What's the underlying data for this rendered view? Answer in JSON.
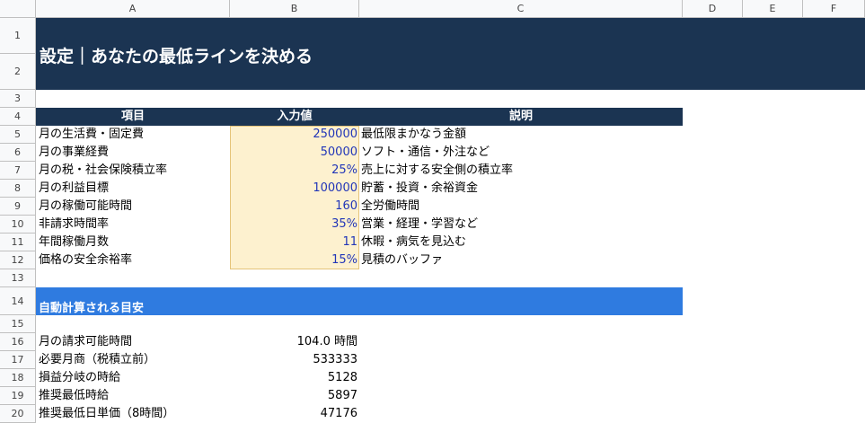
{
  "columns": [
    "A",
    "B",
    "C",
    "D",
    "E",
    "F"
  ],
  "rows": [
    "1",
    "2",
    "3",
    "4",
    "5",
    "6",
    "7",
    "8",
    "9",
    "10",
    "11",
    "12",
    "13",
    "14",
    "15",
    "16",
    "17",
    "18",
    "19",
    "20"
  ],
  "title": "設定｜あなたの最低ラインを決める",
  "table_header": {
    "item": "項目",
    "input": "入力値",
    "description": "説明"
  },
  "settings": [
    {
      "label": "月の生活費・固定費",
      "value": "250000",
      "description": "最低限まかなう金額"
    },
    {
      "label": "月の事業経費",
      "value": "50000",
      "description": "ソフト・通信・外注など"
    },
    {
      "label": "月の税・社会保険積立率",
      "value": "25%",
      "description": "売上に対する安全側の積立率"
    },
    {
      "label": "月の利益目標",
      "value": "100000",
      "description": "貯蓄・投資・余裕資金"
    },
    {
      "label": "月の稼働可能時間",
      "value": "160",
      "description": "全労働時間"
    },
    {
      "label": "非請求時間率",
      "value": "35%",
      "description": "営業・経理・学習など"
    },
    {
      "label": "年間稼働月数",
      "value": "11",
      "description": "休暇・病気を見込む"
    },
    {
      "label": "価格の安全余裕率",
      "value": "15%",
      "description": "見積のバッファ"
    }
  ],
  "auto_section_title": "自動計算される目安",
  "results": [
    {
      "label": "月の請求可能時間",
      "value": "104.0 時間"
    },
    {
      "label": "必要月商（税積立前）",
      "value": "533333"
    },
    {
      "label": "損益分岐の時給",
      "value": "5128"
    },
    {
      "label": "推奨最低時給",
      "value": "5897"
    },
    {
      "label": "推奨最低日単価（8時間）",
      "value": "47176"
    }
  ]
}
